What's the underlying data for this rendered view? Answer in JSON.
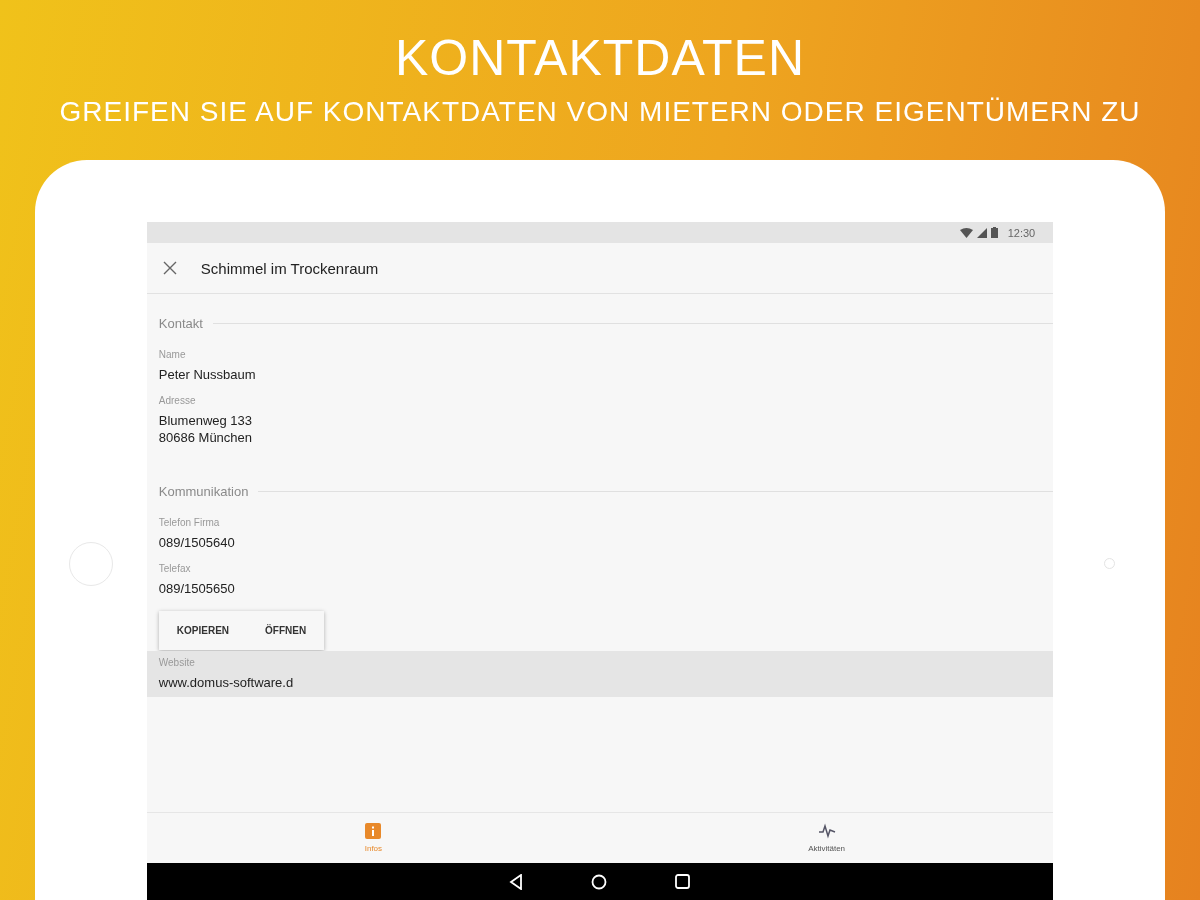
{
  "banner": {
    "title": "KONTAKTDATEN",
    "subtitle": "GREIFEN SIE AUF KONTAKTDATEN VON MIETERN ODER EIGENTÜMERN ZU"
  },
  "status_bar": {
    "time": "12:30"
  },
  "toolbar": {
    "title": "Schimmel im Trockenraum"
  },
  "sections": [
    {
      "title": "Kontakt",
      "fields": [
        {
          "label": "Name",
          "lines": [
            "Peter Nussbaum"
          ],
          "selected": false
        },
        {
          "label": "Adresse",
          "lines": [
            "Blumenweg 133",
            "80686 München"
          ],
          "selected": false
        }
      ]
    },
    {
      "title": "Kommunikation",
      "fields": [
        {
          "label": "Telefon Firma",
          "lines": [
            "089/1505640"
          ],
          "selected": false
        },
        {
          "label": "Telefax",
          "lines": [
            "089/1505650"
          ],
          "selected": false
        },
        {
          "label": "Website",
          "lines": [
            "www.domus-software.d"
          ],
          "selected": true
        }
      ]
    }
  ],
  "context_menu": {
    "items": [
      "KOPIEREN",
      "ÖFFNEN"
    ]
  },
  "bottom_nav": [
    {
      "label": "Infos",
      "kind": "info",
      "selected": true
    },
    {
      "label": "Aktivitäten",
      "kind": "activity",
      "selected": false
    }
  ]
}
